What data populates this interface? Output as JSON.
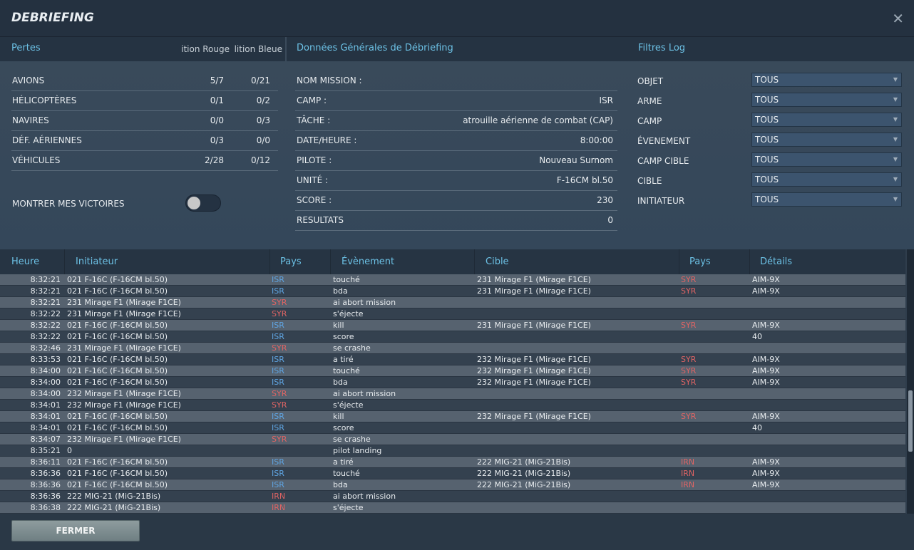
{
  "title": "DEBRIEFING",
  "losses": {
    "header": "Pertes",
    "col_red": "Coalition Rouge",
    "col_blue": "Coalition Bleue",
    "rows": [
      {
        "label": "AVIONS",
        "red": "5/7",
        "blue": "0/21"
      },
      {
        "label": "HÉLICOPTÈRES",
        "red": "0/1",
        "blue": "0/2"
      },
      {
        "label": "NAVIRES",
        "red": "0/0",
        "blue": "0/3"
      },
      {
        "label": "DÉF. AÉRIENNES",
        "red": "0/3",
        "blue": "0/0"
      },
      {
        "label": "VÉHICULES",
        "red": "2/28",
        "blue": "0/12"
      }
    ],
    "toggle_label": "MONTRER MES VICTOIRES",
    "toggle_on": false
  },
  "general": {
    "header": "Données Générales de Débriefing",
    "rows": [
      {
        "label": "NOM MISSION :",
        "value": ""
      },
      {
        "label": "CAMP :",
        "value": "ISR"
      },
      {
        "label": "TÂCHE :",
        "value": "Patrouille aérienne de combat (CAP)"
      },
      {
        "label": "DATE/HEURE :",
        "value": "8:00:00"
      },
      {
        "label": "PILOTE :",
        "value": "Nouveau Surnom"
      },
      {
        "label": "UNITÉ :",
        "value": "F-16CM bl.50"
      },
      {
        "label": "SCORE :",
        "value": "230"
      },
      {
        "label": "RESULTATS",
        "value": "0"
      }
    ]
  },
  "filters": {
    "header": "Filtres Log",
    "rows": [
      {
        "label": "OBJET",
        "value": "TOUS"
      },
      {
        "label": "ARME",
        "value": "TOUS"
      },
      {
        "label": "CAMP",
        "value": "TOUS"
      },
      {
        "label": "ÉVENEMENT",
        "value": "TOUS"
      },
      {
        "label": "CAMP CIBLE",
        "value": "TOUS"
      },
      {
        "label": "CIBLE",
        "value": "TOUS"
      },
      {
        "label": "INITIATEUR",
        "value": "TOUS"
      }
    ]
  },
  "log": {
    "columns": [
      "Heure",
      "Initiateur",
      "Pays",
      "Évènement",
      "Cible",
      "Pays",
      "Détails"
    ],
    "rows": [
      [
        "8:32:21",
        "021 F-16C (F-16CM bl.50)",
        "ISR",
        "touché",
        "231 Mirage F1 (Mirage F1CE)",
        "SYR",
        "AIM-9X"
      ],
      [
        "8:32:21",
        "021 F-16C (F-16CM bl.50)",
        "ISR",
        "bda",
        "231 Mirage F1 (Mirage F1CE)",
        "SYR",
        "AIM-9X"
      ],
      [
        "8:32:21",
        "231 Mirage F1 (Mirage F1CE)",
        "SYR",
        "ai abort mission",
        "",
        "",
        ""
      ],
      [
        "8:32:22",
        "231 Mirage F1 (Mirage F1CE)",
        "SYR",
        "s'éjecte",
        "",
        "",
        ""
      ],
      [
        "8:32:22",
        "021 F-16C (F-16CM bl.50)",
        "ISR",
        "kill",
        "231 Mirage F1 (Mirage F1CE)",
        "SYR",
        "AIM-9X"
      ],
      [
        "8:32:22",
        "021 F-16C (F-16CM bl.50)",
        "ISR",
        "score",
        "",
        "",
        "40"
      ],
      [
        "8:32:46",
        "231 Mirage F1 (Mirage F1CE)",
        "SYR",
        "se crashe",
        "",
        "",
        ""
      ],
      [
        "8:33:53",
        "021 F-16C (F-16CM bl.50)",
        "ISR",
        "a tiré",
        "232 Mirage F1 (Mirage F1CE)",
        "SYR",
        "AIM-9X"
      ],
      [
        "8:34:00",
        "021 F-16C (F-16CM bl.50)",
        "ISR",
        "touché",
        "232 Mirage F1 (Mirage F1CE)",
        "SYR",
        "AIM-9X"
      ],
      [
        "8:34:00",
        "021 F-16C (F-16CM bl.50)",
        "ISR",
        "bda",
        "232 Mirage F1 (Mirage F1CE)",
        "SYR",
        "AIM-9X"
      ],
      [
        "8:34:00",
        "232 Mirage F1 (Mirage F1CE)",
        "SYR",
        "ai abort mission",
        "",
        "",
        ""
      ],
      [
        "8:34:01",
        "232 Mirage F1 (Mirage F1CE)",
        "SYR",
        "s'éjecte",
        "",
        "",
        ""
      ],
      [
        "8:34:01",
        "021 F-16C (F-16CM bl.50)",
        "ISR",
        "kill",
        "232 Mirage F1 (Mirage F1CE)",
        "SYR",
        "AIM-9X"
      ],
      [
        "8:34:01",
        "021 F-16C (F-16CM bl.50)",
        "ISR",
        "score",
        "",
        "",
        "40"
      ],
      [
        "8:34:07",
        "232 Mirage F1 (Mirage F1CE)",
        "SYR",
        "se crashe",
        "",
        "",
        ""
      ],
      [
        "8:35:21",
        "0",
        "",
        "pilot landing",
        "",
        "",
        ""
      ],
      [
        "8:36:11",
        "021 F-16C (F-16CM bl.50)",
        "ISR",
        "a tiré",
        "222 MIG-21 (MiG-21Bis)",
        "IRN",
        "AIM-9X"
      ],
      [
        "8:36:36",
        "021 F-16C (F-16CM bl.50)",
        "ISR",
        "touché",
        "222 MIG-21 (MiG-21Bis)",
        "IRN",
        "AIM-9X"
      ],
      [
        "8:36:36",
        "021 F-16C (F-16CM bl.50)",
        "ISR",
        "bda",
        "222 MIG-21 (MiG-21Bis)",
        "IRN",
        "AIM-9X"
      ],
      [
        "8:36:36",
        "222 MIG-21 (MiG-21Bis)",
        "IRN",
        "ai abort mission",
        "",
        "",
        ""
      ],
      [
        "8:36:38",
        "222 MIG-21 (MiG-21Bis)",
        "IRN",
        "s'éjecte",
        "",
        "",
        ""
      ]
    ]
  },
  "close_button": "FERMER",
  "colors": {
    "accent": "#6cc1e5",
    "isr": "#5fa5e3",
    "enemy": "#e06464"
  }
}
